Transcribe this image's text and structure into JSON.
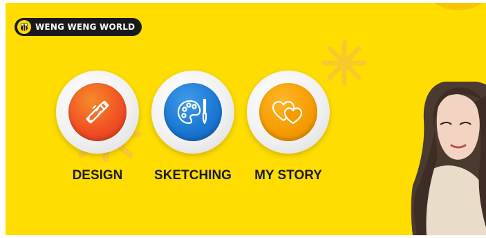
{
  "brand": {
    "name": "WENG WENG WORLD",
    "icon": "bee-icon"
  },
  "categories": [
    {
      "label": "DESIGN",
      "icon": "pencil-ruler-icon",
      "color": "#F04E23"
    },
    {
      "label": "SKETCHING",
      "icon": "palette-brush-icon",
      "color": "#1976D2"
    },
    {
      "label": "MY STORY",
      "icon": "hearts-icon",
      "color": "#F59B00"
    }
  ],
  "colors": {
    "background": "#FFDD00",
    "text": "#1a1a1a"
  }
}
